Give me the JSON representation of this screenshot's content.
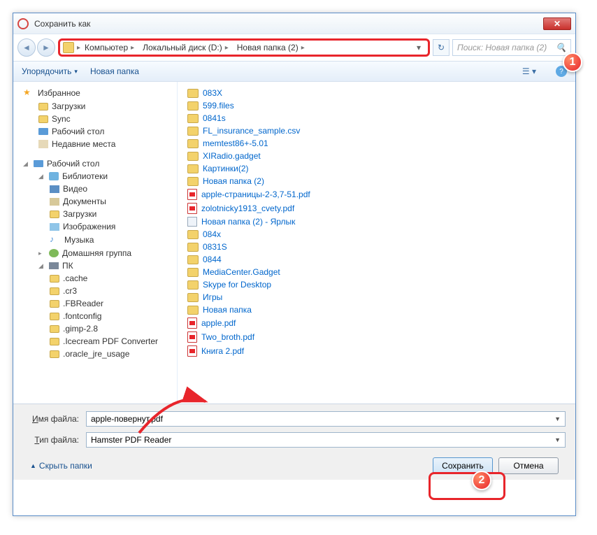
{
  "window": {
    "title": "Сохранить как"
  },
  "breadcrumb": {
    "segments": [
      "Компьютер",
      "Локальный диск (D:)",
      "Новая папка (2)"
    ]
  },
  "search": {
    "placeholder": "Поиск: Новая папка (2)"
  },
  "toolbar": {
    "organize": "Упорядочить",
    "new_folder": "Новая папка"
  },
  "tree": {
    "favorites": {
      "label": "Избранное",
      "items": [
        "Загрузки",
        "Sync",
        "Рабочий стол",
        "Недавние места"
      ]
    },
    "desktop": {
      "label": "Рабочий стол"
    },
    "libraries": {
      "label": "Библиотеки",
      "items": [
        "Видео",
        "Документы",
        "Загрузки",
        "Изображения",
        "Музыка"
      ]
    },
    "homegroup": {
      "label": "Домашняя группа"
    },
    "pc": {
      "label": "ПК",
      "items": [
        ".cache",
        ".cr3",
        ".FBReader",
        ".fontconfig",
        ".gimp-2.8",
        ".Icecream PDF Converter",
        ".oracle_jre_usage"
      ]
    }
  },
  "files": {
    "col1": [
      {
        "name": "083X",
        "type": "folder"
      },
      {
        "name": "599.files",
        "type": "folder"
      },
      {
        "name": "0841s",
        "type": "folder"
      },
      {
        "name": "FL_insurance_sample.csv",
        "type": "folder"
      },
      {
        "name": "memtest86+-5.01",
        "type": "folder"
      },
      {
        "name": "XIRadio.gadget",
        "type": "folder"
      },
      {
        "name": "Картинки(2)",
        "type": "folder"
      },
      {
        "name": "Новая папка (2)",
        "type": "folder"
      },
      {
        "name": "apple-страницы-2-3,7-51.pdf",
        "type": "pdf"
      },
      {
        "name": "zolotnicky1913_cvety.pdf",
        "type": "pdf"
      },
      {
        "name": "Новая папка (2) - Ярлык",
        "type": "link"
      }
    ],
    "col2": [
      {
        "name": "084x",
        "type": "folder"
      },
      {
        "name": "0831S",
        "type": "folder"
      },
      {
        "name": "0844",
        "type": "folder"
      },
      {
        "name": "MediaCenter.Gadget",
        "type": "folder"
      },
      {
        "name": "Skype for Desktop",
        "type": "folder"
      },
      {
        "name": "Игры",
        "type": "folder"
      },
      {
        "name": "Новая папка",
        "type": "folder"
      },
      {
        "name": "apple.pdf",
        "type": "pdf"
      },
      {
        "name": "Two_broth.pdf",
        "type": "pdf"
      },
      {
        "name": "Книга 2.pdf",
        "type": "pdf"
      }
    ]
  },
  "fields": {
    "filename_label": "Имя файла:",
    "filename_value": "apple-повернут.pdf",
    "filetype_label": "Тип файла:",
    "filetype_value": "Hamster PDF Reader"
  },
  "footer": {
    "hide_folders": "Скрыть папки",
    "save": "Сохранить",
    "cancel": "Отмена"
  },
  "badges": {
    "one": "1",
    "two": "2"
  }
}
